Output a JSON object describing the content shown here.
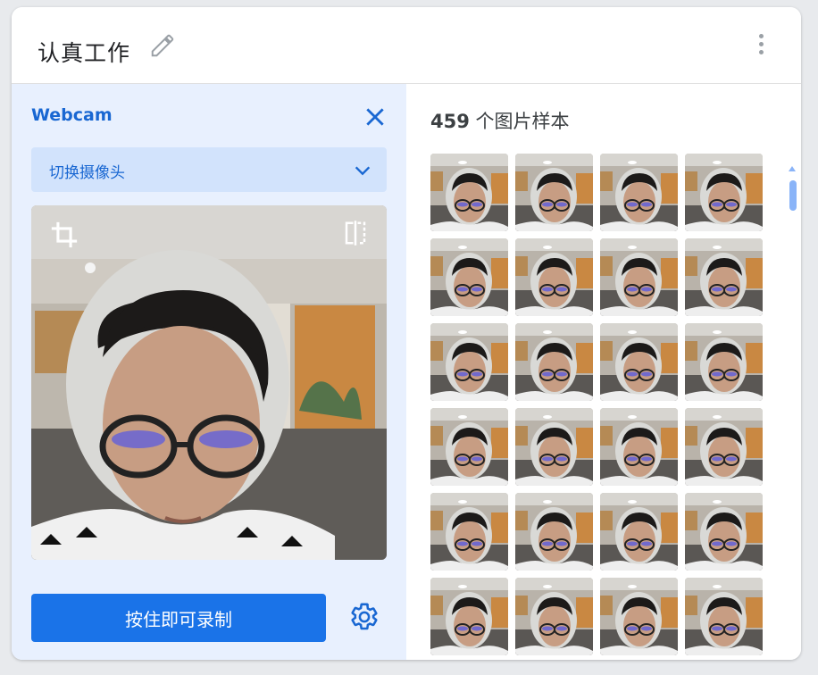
{
  "project": {
    "title": "认真工作"
  },
  "webcam": {
    "label": "Webcam",
    "camera_select": "切换摄像头",
    "record_button": "按住即可录制"
  },
  "samples": {
    "count": "459",
    "label": " 个图片样本",
    "thumbnail_count": 24
  },
  "icons": [
    "edit-icon",
    "more-vert-icon",
    "close-icon",
    "chevron-down-icon",
    "crop-icon",
    "flip-icon",
    "gear-icon"
  ],
  "colors": {
    "accent": "#1a73e8",
    "accent_text": "#1967d2",
    "panel_bg": "#e8f0fe",
    "select_bg": "#d2e3fc"
  }
}
